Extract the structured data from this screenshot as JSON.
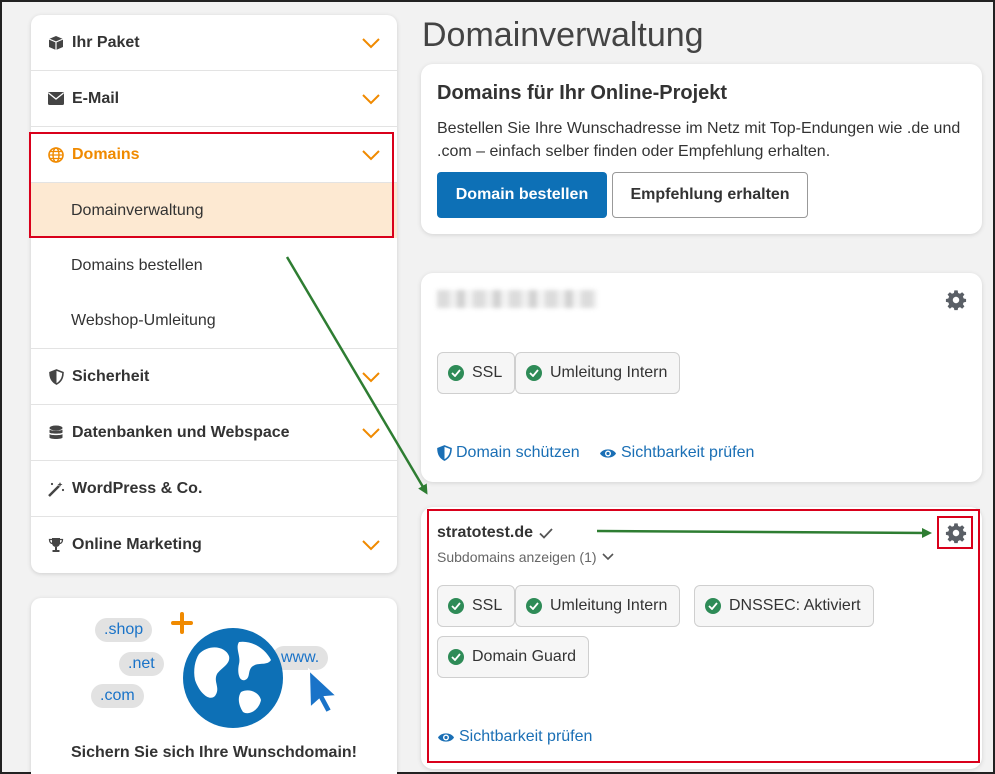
{
  "page_title": "Domainverwaltung",
  "sidebar": {
    "items": [
      {
        "label": "Ihr Paket",
        "icon": "box-icon"
      },
      {
        "label": "E-Mail",
        "icon": "envelope-icon"
      },
      {
        "label": "Domains",
        "icon": "globe-icon",
        "active": true,
        "subitems": [
          "Domainverwaltung",
          "Domains bestellen",
          "Webshop-Umleitung"
        ]
      },
      {
        "label": "Sicherheit",
        "icon": "shield-icon"
      },
      {
        "label": "Datenbanken und Webspace",
        "icon": "database-icon"
      },
      {
        "label": "WordPress & Co.",
        "icon": "magic-wand-icon"
      },
      {
        "label": "Online Marketing",
        "icon": "trophy-icon"
      }
    ]
  },
  "promo": {
    "bubbles": [
      ".shop",
      ".net",
      ".com",
      "www."
    ],
    "text": "Sichern Sie sich Ihre Wunschdomain!"
  },
  "order_card": {
    "title": "Domains für Ihr Online-Projekt",
    "description": "Bestellen Sie Ihre Wunschadresse im Netz mit Top-Endungen wie .de und .com – einfach selber finden oder Empfehlung erhalten.",
    "primary_button": "Domain bestellen",
    "secondary_button": "Empfehlung erhalten"
  },
  "domain_card_1": {
    "tags": [
      "SSL",
      "Umleitung Intern"
    ],
    "links": [
      "Domain schützen",
      "Sichtbarkeit prüfen"
    ]
  },
  "domain_card_2": {
    "domain": "stratotest.de",
    "subdomains": "Subdomains anzeigen (1)",
    "tags": [
      "SSL",
      "Umleitung Intern",
      "DNSSEC: Aktiviert",
      "Domain Guard"
    ],
    "link": "Sichtbarkeit prüfen"
  },
  "colors": {
    "accent_orange": "#f08a00",
    "primary_blue": "#0d70b6",
    "link_blue": "#1a6fb5",
    "highlight_red": "#d9001b",
    "arrow_green": "#2e7d32",
    "check_green": "#2e8b57"
  }
}
